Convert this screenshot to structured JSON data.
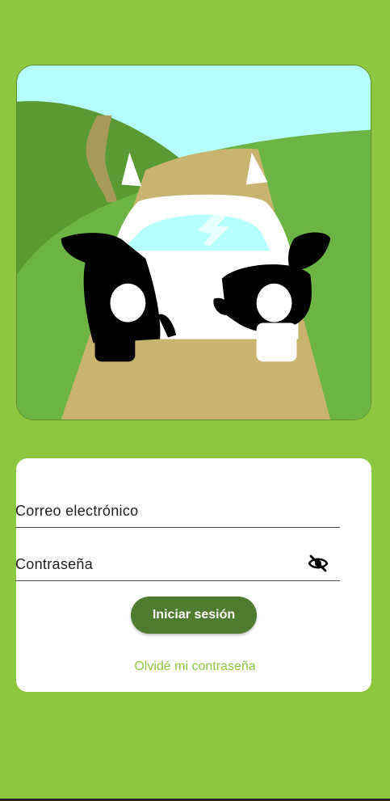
{
  "hero": {
    "image_name": "cow-car-illustration"
  },
  "login": {
    "email_placeholder": "Correo electrónico",
    "password_placeholder": "Contraseña",
    "visibility_icon": "eye-off-icon",
    "submit_label": "Iniciar sesión",
    "forgot_label": "Olvidé mi contraseña"
  },
  "colors": {
    "background": "#8dc63f",
    "button": "#4f7b2e",
    "link": "#8dc63f"
  }
}
